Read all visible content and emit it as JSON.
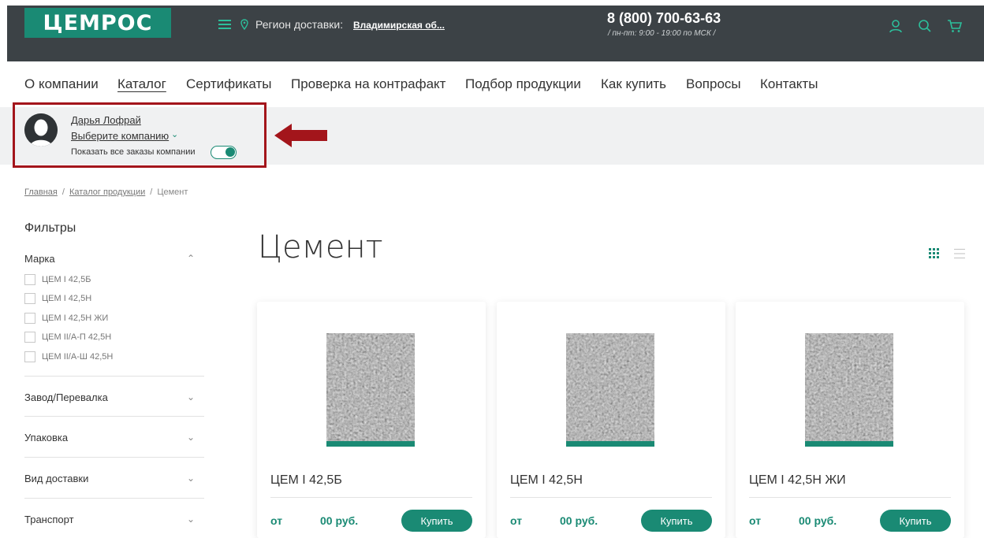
{
  "header": {
    "logo": "ЦЕМРОС",
    "region_label": "Регион доставки:",
    "region_value": "Владимирская об...",
    "phone": "8 (800) 700-63-63",
    "hours": "/ пн-пт: 9:00 - 19:00 по МСК /",
    "icons": [
      "menu-icon",
      "location-pin-icon",
      "user-icon",
      "search-icon",
      "cart-icon"
    ],
    "accent": "#1a8a74",
    "bg": "#3c4246"
  },
  "nav": {
    "items": [
      {
        "label": "О компании",
        "active": false
      },
      {
        "label": "Каталог",
        "active": true
      },
      {
        "label": "Сертификаты",
        "active": false
      },
      {
        "label": "Проверка на контрафакт",
        "active": false
      },
      {
        "label": "Подбор продукции",
        "active": false
      },
      {
        "label": "Как купить",
        "active": false
      },
      {
        "label": "Вопросы",
        "active": false
      },
      {
        "label": "Контакты",
        "active": false
      }
    ]
  },
  "user": {
    "name": "Дарья Лофрай",
    "company_select": "Выберите компанию",
    "show_all_label": "Показать все заказы компании",
    "show_all_enabled": true,
    "highlight_color": "#a3151b"
  },
  "breadcrumb": {
    "items": [
      "Главная",
      "Каталог продукции",
      "Цемент"
    ]
  },
  "filters": {
    "title": "Фильтры",
    "groups": [
      {
        "label": "Марка",
        "expanded": true,
        "options": [
          "ЦЕМ I 42,5Б",
          "ЦЕМ I 42,5Н",
          "ЦЕМ I 42,5Н ЖИ",
          "ЦЕМ II/А-П 42,5Н",
          "ЦЕМ II/А-Ш 42,5Н"
        ]
      },
      {
        "label": "Завод/Перевалка",
        "expanded": false
      },
      {
        "label": "Упаковка",
        "expanded": false
      },
      {
        "label": "Вид доставки",
        "expanded": false
      },
      {
        "label": "Транспорт",
        "expanded": false
      }
    ]
  },
  "catalog": {
    "title": "Цемент",
    "view_mode": "grid",
    "products": [
      {
        "name": "ЦЕМ I 42,5Б",
        "from": "от",
        "price": "00 руб.",
        "buy": "Купить"
      },
      {
        "name": "ЦЕМ I 42,5Н",
        "from": "от",
        "price": "00 руб.",
        "buy": "Купить"
      },
      {
        "name": "ЦЕМ I 42,5Н ЖИ",
        "from": "от",
        "price": "00 руб.",
        "buy": "Купить"
      }
    ]
  }
}
